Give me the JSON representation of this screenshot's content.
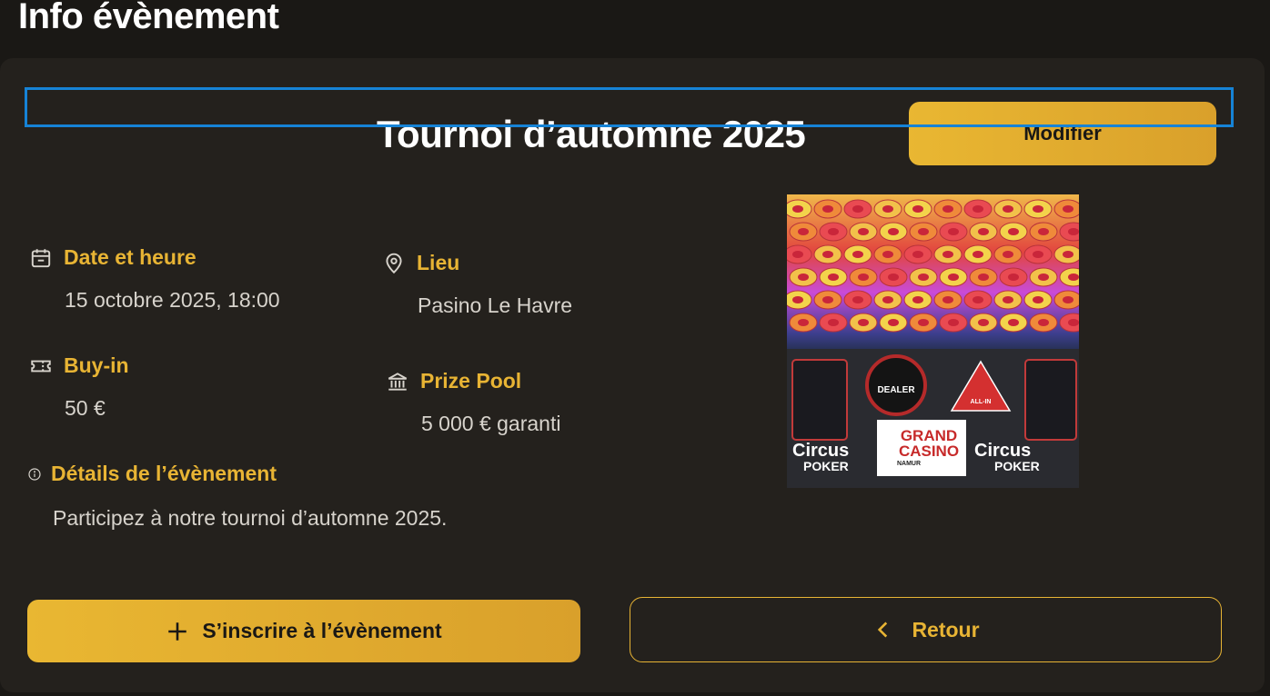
{
  "page": {
    "title": "Info évènement"
  },
  "event": {
    "title": "Tournoi d’automne 2025",
    "edit_label": "Modifier",
    "date": {
      "label": "Date et heure",
      "value": "15 octobre 2025, 18:00",
      "icon": "calendar-icon"
    },
    "location": {
      "label": "Lieu",
      "value": "Pasino Le Havre",
      "icon": "map-pin-icon"
    },
    "buyin": {
      "label": "Buy-in",
      "value": "50 €",
      "icon": "ticket-icon"
    },
    "prize": {
      "label": "Prize Pool",
      "value": "5 000 € garanti",
      "icon": "bank-icon"
    },
    "details": {
      "label": "Détails de l’évènement",
      "value": "Participez à notre tournoi d’automne 2025.",
      "icon": "info-icon"
    },
    "image": {
      "dealer_text": "DEALER",
      "allin_text": "ALL-IN",
      "circus_left": "Circus",
      "poker_left": "POKER",
      "grand": "GRAND",
      "casino": "CASINO",
      "namur": "NAMUR",
      "circus_right": "Circus",
      "poker_right": "POKER"
    }
  },
  "actions": {
    "register_label": "S’inscrire à l’évènement",
    "back_label": "Retour"
  },
  "colors": {
    "accent": "#e8b434",
    "background": "#1a1815",
    "card": "#24211d",
    "selection": "#1683d6"
  }
}
